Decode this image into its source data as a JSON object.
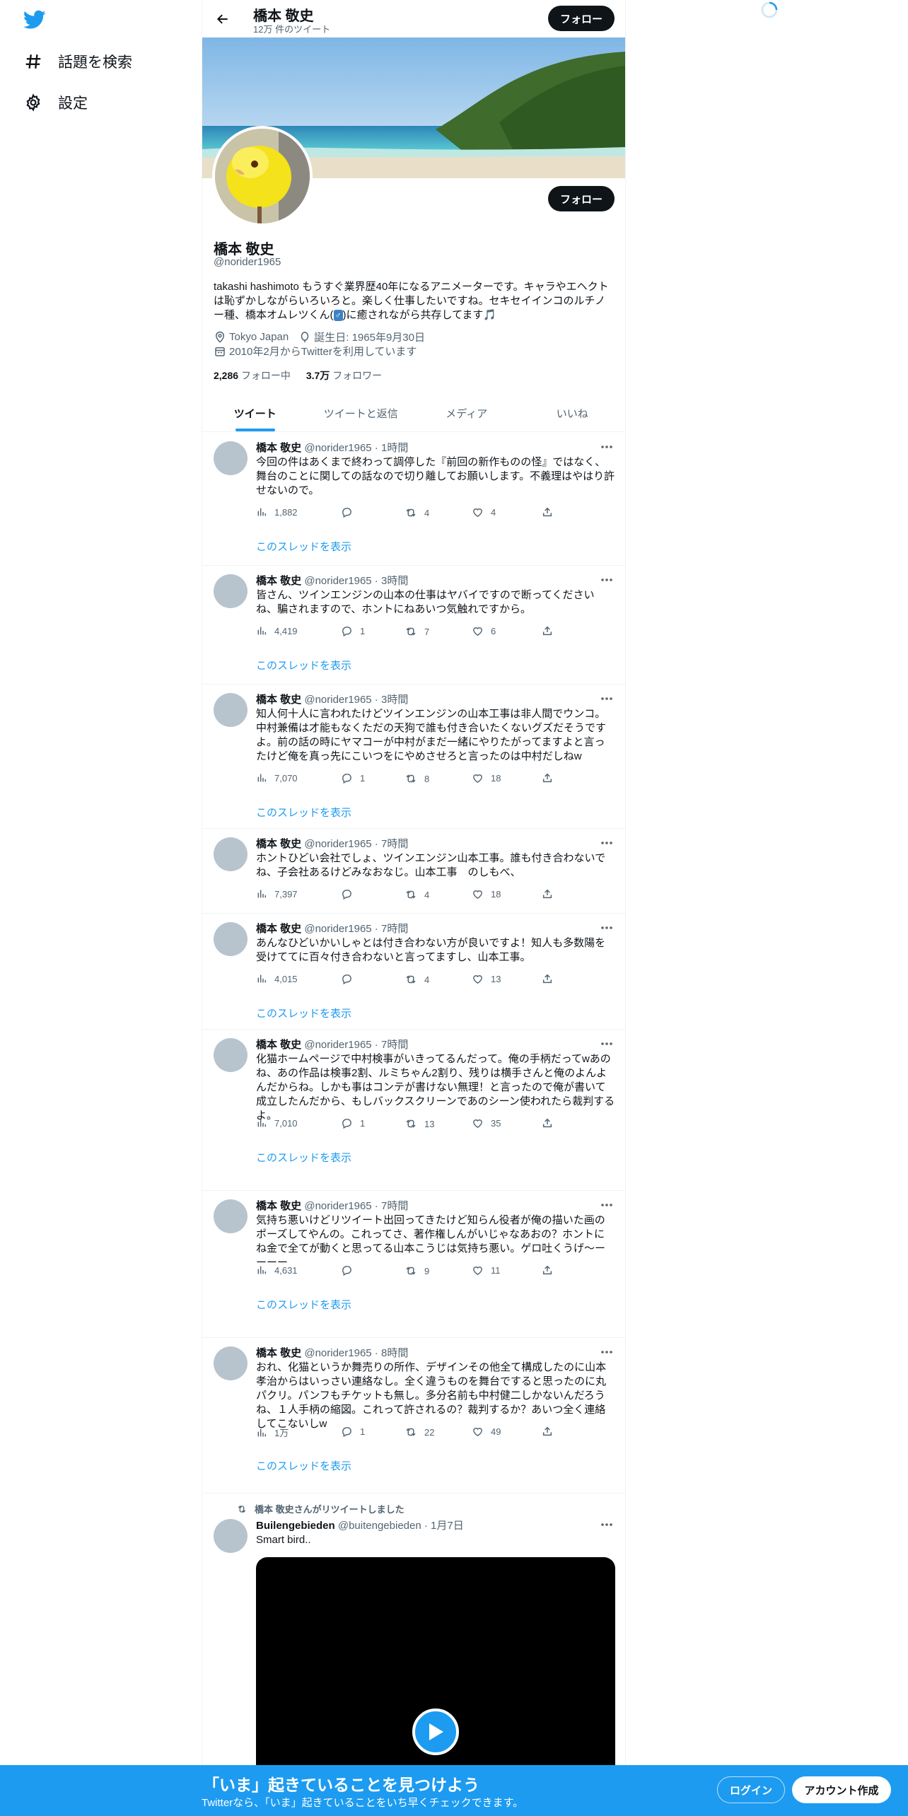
{
  "nav": {
    "items": [
      {
        "label": "話題を検索",
        "icon": "hashtag-icon"
      },
      {
        "label": "設定",
        "icon": "gear-icon"
      }
    ]
  },
  "header": {
    "name": "橋本 敬史",
    "tweet_count": "12万 件のツイート",
    "follow_label": "フォロー"
  },
  "profile": {
    "name": "橋本 敬史",
    "handle": "@norider1965",
    "bio_main": "takashi hashimoto もうすぐ業界歴40年になるアニメーターです。キャラやエヘクトは恥ずかしながらいろいろと。楽しく仕事したいですね。セキセイインコのルチノー種、橋本オムレツくん(",
    "bio_emoji": "♂",
    "bio_end": ")に癒されながら共存してます",
    "bio_note": "🎵",
    "location": "Tokyo Japan",
    "birthday": "誕生日: 1965年9月30日",
    "joined": "2010年2月からTwitterを利用しています",
    "following_count": "2,286",
    "following_label": "フォロー中",
    "followers_count": "3.7万",
    "followers_label": "フォロワー",
    "follow_label": "フォロー"
  },
  "tabs": [
    {
      "label": "ツイート",
      "active": true
    },
    {
      "label": "ツイートと返信",
      "active": false
    },
    {
      "label": "メディア",
      "active": false
    },
    {
      "label": "いいね",
      "active": false
    }
  ],
  "thread_label": "このスレッドを表示",
  "tweets": [
    {
      "name": "橋本 敬史",
      "handle": "@norider1965",
      "time": "1時間",
      "text": "今回の件はあくまで終わって調停した『前回の新作ものの怪』ではなく、舞台のことに関しての話なので切り離してお願いします。不義理はやはり許せないので。",
      "views": "1,882",
      "replies": "",
      "retweets": "4",
      "likes": "4",
      "thread": true
    },
    {
      "name": "橋本 敬史",
      "handle": "@norider1965",
      "time": "3時間",
      "text": "皆さん、ツインエンジンの山本の仕事はヤバイですので断ってくださいね、騙されますので、ホントにねあいつ気触れですから。",
      "views": "4,419",
      "replies": "1",
      "retweets": "7",
      "likes": "6",
      "thread": true
    },
    {
      "name": "橋本 敬史",
      "handle": "@norider1965",
      "time": "3時間",
      "text": "知人何十人に言われたけどツインエンジンの山本工事は非人間でウンコ。中村兼備は才能もなくただの天狗で誰も付き合いたくないグズだそうですよ。前の話の時にヤマコーが中村がまだ一緒にやりたがってますよと言ったけど俺を真っ先にこいつをにやめさせろと言ったのは中村だしねw",
      "views": "7,070",
      "replies": "1",
      "retweets": "8",
      "likes": "18",
      "thread": true
    },
    {
      "name": "橋本 敬史",
      "handle": "@norider1965",
      "time": "7時間",
      "text": "ホントひどい会社でしょ、ツインエンジン山本工事。誰も付き合わないでね、子会社あるけどみなおなじ。山本工事　のしもべ、",
      "views": "7,397",
      "replies": "",
      "retweets": "4",
      "likes": "18",
      "thread": false
    },
    {
      "name": "橋本 敬史",
      "handle": "@norider1965",
      "time": "7時間",
      "text": "あんなひどいかいしゃとは付き合わない方が良いですよ！知人も多数陽を受けててに百々付き合わないと言ってますし、山本工事。",
      "views": "4,015",
      "replies": "",
      "retweets": "4",
      "likes": "13",
      "thread": true
    },
    {
      "name": "橋本 敬史",
      "handle": "@norider1965",
      "time": "7時間",
      "text": "化猫ホームページで中村検事がいきってるんだって。俺の手柄だってwあのね、あの作品は検事2割、ルミちゃん2割り、残りは横手さんと俺のよんよんだからね。しかも事はコンテが書けない無理！と言ったので俺が書いて成立したんだから、もしバックスクリーンであのシーン使われたら裁判するよ。",
      "views": "7,010",
      "replies": "1",
      "retweets": "13",
      "likes": "35",
      "thread": true
    },
    {
      "name": "橋本 敬史",
      "handle": "@norider1965",
      "time": "7時間",
      "text": "気持ち悪いけどリツイート出回ってきたけど知らん役者が俺の描いた画のポーズしてやんの。これってさ、著作権しんがいじゃなあおの？ホントにね金で全てが動くと思ってる山本こうじは気持ち悪い。ゲロ吐くうげ～ーーーー",
      "views": "4,631",
      "replies": "",
      "retweets": "9",
      "likes": "11",
      "thread": true
    },
    {
      "name": "橋本 敬史",
      "handle": "@norider1965",
      "time": "8時間",
      "text": "おれ、化猫というか舞売りの所作、デザインその他全て構成したのに山本孝治からはいっさい連絡なし。全く違うものを舞台ですると思ったのに丸パクリ。パンフもチケットも無し。多分名前も中村健二しかないんだろうね、１人手柄の縮図。これって許されるの？裁判するか？あいつ全く連絡してこないしw",
      "views": "1万",
      "replies": "1",
      "retweets": "22",
      "likes": "49",
      "thread": true
    }
  ],
  "retweet": {
    "label": "橋本 敬史さんがリツイートしました",
    "name": "Builengebieden",
    "handle": "@buitengebieden",
    "time": "1月7日",
    "text": "Smart bird.."
  },
  "bottom_bar": {
    "title": "「いま」起きていることを見つけよう",
    "subtitle": "Twitterなら、「いま」起きていることをいち早くチェックできます。",
    "login": "ログイン",
    "signup": "アカウント作成"
  },
  "colors": {
    "accent": "#1d9bf0",
    "text": "#0f1419",
    "muted": "#536471"
  }
}
